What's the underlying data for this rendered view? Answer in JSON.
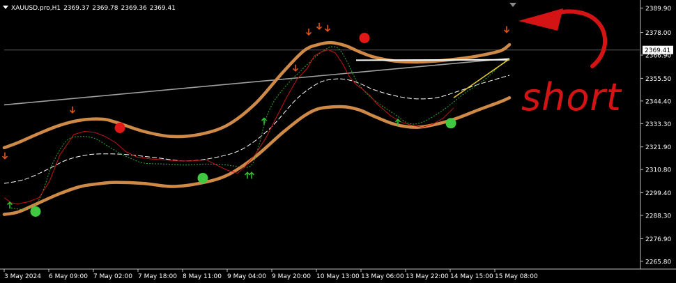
{
  "header": {
    "symbol": "XAUUSD.pro,H1",
    "open": "2369.37",
    "high": "2369.78",
    "low": "2369.36",
    "close": "2369.41"
  },
  "colors": {
    "background": "#000000",
    "axis": "#c0c0c0",
    "envelope": "#d08a48",
    "price": "#c81414",
    "mid_dash": "#ffffff",
    "signal_dash": "#30b030",
    "trendline": "#a0a0a0",
    "current_line": "#606060",
    "buy_dot": "#40c840",
    "sell_dot": "#e01818",
    "up_arrow": "#30c030",
    "down_arrow": "#e0561c",
    "annotation": "#d41414",
    "yellow_line": "#e8d030"
  },
  "annotation": {
    "text": "short"
  },
  "current_price_label": "2369.41",
  "chart_data": {
    "type": "line",
    "title": "",
    "ylim": [
      2262.0,
      2392.2
    ],
    "xlim": [
      0,
      712
    ],
    "x_ticks": [
      {
        "x": 0,
        "label": "3 May 2024"
      },
      {
        "x": 64,
        "label": "6 May 09:00"
      },
      {
        "x": 128,
        "label": "7 May 02:00"
      },
      {
        "x": 192,
        "label": "7 May 18:00"
      },
      {
        "x": 256,
        "label": "8 May 11:00"
      },
      {
        "x": 320,
        "label": "9 May 04:00"
      },
      {
        "x": 384,
        "label": "9 May 20:00"
      },
      {
        "x": 448,
        "label": "10 May 13:00"
      },
      {
        "x": 512,
        "label": "13 May 06:00"
      },
      {
        "x": 576,
        "label": "13 May 22:00"
      },
      {
        "x": 640,
        "label": "14 May 15:00"
      },
      {
        "x": 704,
        "label": "15 May 08:00"
      }
    ],
    "y_ticks": [
      "2389.90",
      "2378.00",
      "2366.90",
      "2355.50",
      "2344.40",
      "2333.30",
      "2321.90",
      "2310.80",
      "2299.40",
      "2288.30",
      "2276.90",
      "2265.80"
    ],
    "current_price": 2369.41,
    "series": [
      {
        "role": "upper_envelope",
        "x": [
          0,
          20,
          50,
          80,
          110,
          140,
          160,
          200,
          240,
          280,
          320,
          360,
          400,
          430,
          450,
          470,
          490,
          510,
          530,
          560,
          590,
          620,
          650,
          680,
          712,
          725
        ],
        "y": [
          2321.5,
          2324.0,
          2328.5,
          2332.5,
          2335.0,
          2335.5,
          2334.0,
          2329.5,
          2327.0,
          2328.0,
          2332.5,
          2343.0,
          2358.5,
          2369.0,
          2372.0,
          2373.0,
          2371.5,
          2368.5,
          2366.0,
          2364.0,
          2363.5,
          2364.0,
          2365.0,
          2366.5,
          2369.0,
          2372.0
        ]
      },
      {
        "role": "lower_envelope",
        "x": [
          0,
          20,
          50,
          80,
          110,
          140,
          160,
          200,
          240,
          280,
          320,
          360,
          400,
          430,
          450,
          470,
          490,
          510,
          530,
          560,
          590,
          620,
          650,
          680,
          712,
          725
        ],
        "y": [
          2288.8,
          2290.0,
          2294.5,
          2299.0,
          2302.5,
          2304.0,
          2304.5,
          2304.0,
          2302.5,
          2304.0,
          2308.0,
          2317.0,
          2329.0,
          2337.0,
          2340.5,
          2341.5,
          2341.5,
          2340.0,
          2337.0,
          2333.0,
          2331.5,
          2333.0,
          2336.0,
          2340.0,
          2344.0,
          2346.0
        ]
      },
      {
        "role": "middle_dashed",
        "x": [
          0,
          30,
          60,
          90,
          120,
          150,
          180,
          220,
          260,
          300,
          340,
          380,
          420,
          450,
          470,
          490,
          510,
          530,
          560,
          590,
          620,
          650,
          680,
          700,
          725
        ],
        "y": [
          2304.0,
          2306.0,
          2310.5,
          2315.5,
          2318.0,
          2318.5,
          2318.0,
          2316.5,
          2315.0,
          2316.5,
          2320.5,
          2330.5,
          2345.5,
          2353.0,
          2355.0,
          2355.0,
          2353.0,
          2350.0,
          2347.0,
          2345.5,
          2346.0,
          2349.0,
          2352.5,
          2354.5,
          2357.0
        ]
      },
      {
        "role": "price",
        "x": [
          0,
          10,
          20,
          35,
          50,
          65,
          80,
          100,
          115,
          130,
          145,
          160,
          175,
          190,
          210,
          230,
          250,
          270,
          290,
          305,
          320,
          335,
          345,
          360,
          375,
          390,
          405,
          420,
          435,
          445,
          455,
          465,
          475,
          485,
          495,
          505,
          515,
          525,
          535,
          545,
          555,
          570,
          585,
          600,
          615,
          630,
          645
        ],
        "y": [
          2297.0,
          2294.5,
          2294.0,
          2295.0,
          2297.0,
          2305.0,
          2318.0,
          2328.0,
          2329.5,
          2329.0,
          2327.0,
          2324.0,
          2319.5,
          2317.0,
          2316.0,
          2315.5,
          2315.0,
          2315.0,
          2315.5,
          2313.0,
          2310.5,
          2309.0,
          2312.0,
          2318.0,
          2326.0,
          2336.0,
          2346.0,
          2355.0,
          2360.5,
          2366.5,
          2368.5,
          2369.5,
          2368.0,
          2363.0,
          2356.5,
          2352.5,
          2350.0,
          2347.0,
          2343.0,
          2340.0,
          2337.0,
          2334.0,
          2332.5,
          2331.5,
          2333.0,
          2336.0,
          2341.0
        ]
      },
      {
        "role": "signal_dashed",
        "x": [
          10,
          30,
          50,
          70,
          90,
          110,
          130,
          150,
          165,
          180,
          200,
          230,
          260,
          290,
          320,
          340,
          355,
          365,
          375,
          385,
          395,
          410,
          425,
          440,
          450,
          460,
          470,
          480,
          490,
          500,
          510,
          530,
          560,
          580,
          600,
          630,
          660,
          690,
          712,
          725
        ],
        "y": [
          2292.0,
          2291.5,
          2296.0,
          2314.0,
          2325.0,
          2327.0,
          2326.0,
          2322.0,
          2319.0,
          2316.5,
          2314.0,
          2313.5,
          2313.0,
          2313.5,
          2313.0,
          2312.0,
          2313.0,
          2322.0,
          2335.0,
          2343.0,
          2348.0,
          2354.0,
          2359.0,
          2364.0,
          2367.0,
          2369.5,
          2371.0,
          2370.0,
          2365.0,
          2358.0,
          2352.0,
          2345.0,
          2338.0,
          2333.5,
          2334.0,
          2340.0,
          2348.0,
          2355.0,
          2362.0,
          2365.0
        ]
      },
      {
        "role": "trendline",
        "x": [
          0,
          725
        ],
        "y": [
          2342.5,
          2365.3
        ]
      },
      {
        "role": "horizontal_white",
        "x": [
          505,
          725
        ],
        "y": [
          2364.4,
          2364.6
        ]
      },
      {
        "role": "yellow_line",
        "x": [
          645,
          725
        ],
        "y": [
          2346.0,
          2365.0
        ]
      }
    ],
    "buy_dots": [
      {
        "x": 45,
        "y": 2290.2
      },
      {
        "x": 285,
        "y": 2306.6
      },
      {
        "x": 641,
        "y": 2333.5
      }
    ],
    "sell_dots": [
      {
        "x": 166,
        "y": 2331.2
      },
      {
        "x": 517,
        "y": 2375.3
      }
    ],
    "up_arrows": [
      {
        "x": 8,
        "y": 2293.4
      },
      {
        "x": 349,
        "y": 2308.0
      },
      {
        "x": 355,
        "y": 2308.0
      },
      {
        "x": 373,
        "y": 2334.6
      },
      {
        "x": 565,
        "y": 2334.0
      }
    ],
    "down_arrows": [
      {
        "x": 1,
        "y": 2317.5
      },
      {
        "x": 98,
        "y": 2340.0
      },
      {
        "x": 418,
        "y": 2360.5
      },
      {
        "x": 437,
        "y": 2378.2
      },
      {
        "x": 452,
        "y": 2381.0
      },
      {
        "x": 464,
        "y": 2380.0
      },
      {
        "x": 721,
        "y": 2379.4
      }
    ]
  }
}
